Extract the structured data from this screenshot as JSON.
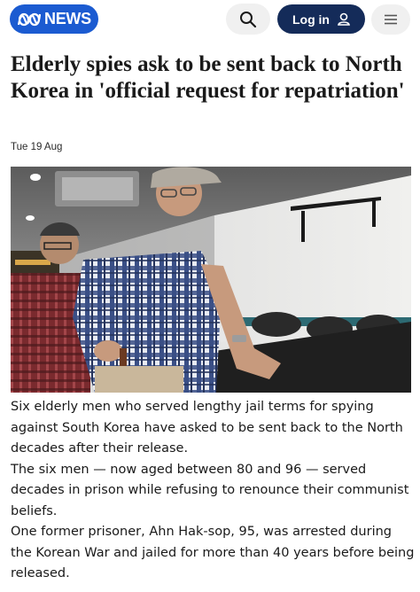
{
  "header": {
    "logo_text": "NEWS",
    "login_label": "Log in",
    "icons": [
      "abc-logo-icon",
      "search-icon",
      "user-icon",
      "menu-icon"
    ]
  },
  "article": {
    "headline": "Elderly spies ask to be sent back to North Korea in 'official request for repatriation'",
    "date": "Tue 19 Aug",
    "paragraphs": [
      "Six elderly men who served lengthy jail terms for spying against South Korea have asked to be sent back to the North decades after their release.",
      "The six men — now aged between 80 and 96 — served decades in prison while refusing to renounce their communist beliefs.",
      "One former prisoner, Ahn Hak-sop, 95, was arrested during the Korean War and jailed for more than 40 years before being released."
    ]
  },
  "colors": {
    "brand_blue": "#1b5bd1",
    "login_navy": "#142b59",
    "pill_grey": "#f0f0f0"
  }
}
